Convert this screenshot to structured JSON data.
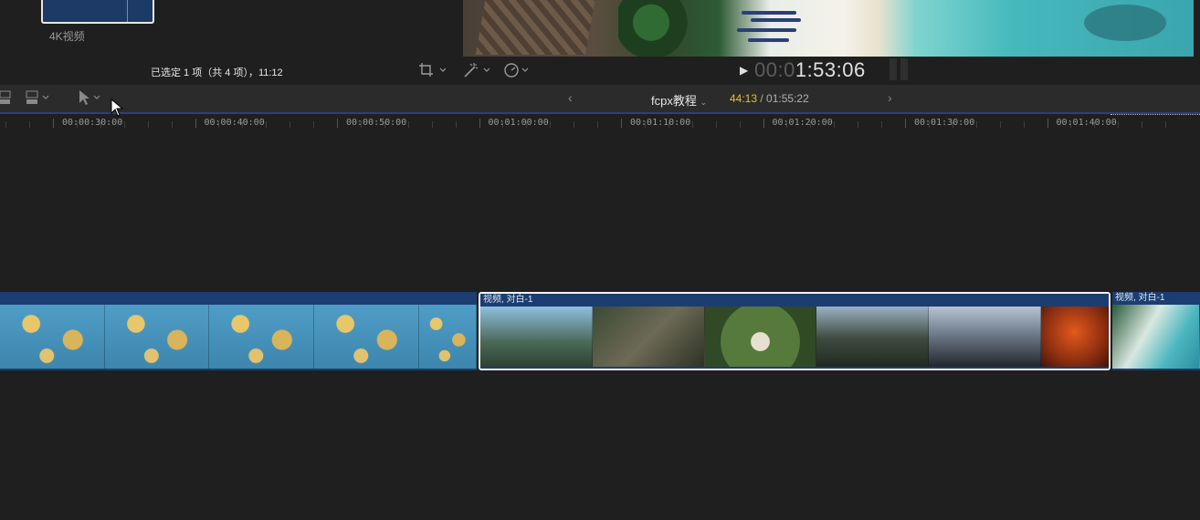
{
  "browser": {
    "thumb_label": "4K视频",
    "selection_status": "已选定 1 项（共 4 项），11:12"
  },
  "viewer": {
    "timecode_dim": "00:0",
    "timecode_bright": "1:53:06"
  },
  "timeline": {
    "project_name": "fcpx教程",
    "project_time_current": "44:13",
    "project_time_total": " / 01:55:22",
    "ruler_labels": [
      "00:00:30:00",
      "00:00:40:00",
      "00:00:50:00",
      "00:01:00:00",
      "00:01:10:00",
      "00:01:20:00",
      "00:01:30:00",
      "00:01:40:00"
    ],
    "clips": [
      {
        "title": ""
      },
      {
        "title": "视频, 对白-1"
      },
      {
        "title": "视频, 对白-1"
      }
    ]
  },
  "icons": {
    "crop": "crop-icon",
    "magic": "magic-wand-icon",
    "speed": "speed-icon",
    "select": "select-arrow-icon"
  },
  "colors": {
    "playhead_time": "#e4c233",
    "clip_header": "#1c3d72",
    "selection_border": "#f2f2f2"
  }
}
